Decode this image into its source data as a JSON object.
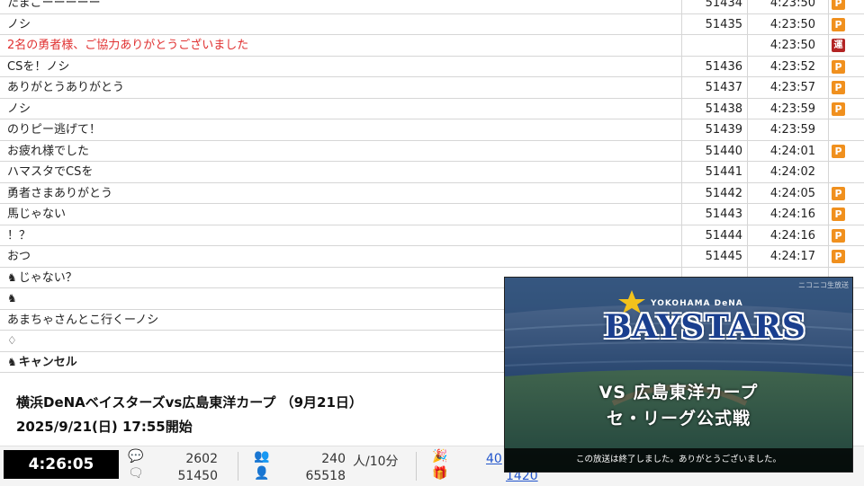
{
  "comments": [
    {
      "text": "たまごーーーーー",
      "no": "51434",
      "time": "4:23:50",
      "badge": "P"
    },
    {
      "text": "ノシ",
      "no": "51435",
      "time": "4:23:50",
      "badge": "P"
    },
    {
      "text": "2名の勇者様、ご協力ありがとうございました",
      "no": "",
      "time": "4:23:50",
      "badge": "運",
      "style": "red"
    },
    {
      "text": "CSを！ノシ",
      "no": "51436",
      "time": "4:23:52",
      "badge": "P"
    },
    {
      "text": "ありがとうありがとう",
      "no": "51437",
      "time": "4:23:57",
      "badge": "P"
    },
    {
      "text": "ノシ",
      "no": "51438",
      "time": "4:23:59",
      "badge": "P"
    },
    {
      "text": "のりピー逃げて！",
      "no": "51439",
      "time": "4:23:59",
      "badge": ""
    },
    {
      "text": "お疲れ様でした",
      "no": "51440",
      "time": "4:24:01",
      "badge": "P"
    },
    {
      "text": "ハマスタでCSを",
      "no": "51441",
      "time": "4:24:02",
      "badge": ""
    },
    {
      "text": "勇者さまありがとう",
      "no": "51442",
      "time": "4:24:05",
      "badge": "P"
    },
    {
      "text": "馬じゃない",
      "no": "51443",
      "time": "4:24:16",
      "badge": "P"
    },
    {
      "text": "！？",
      "no": "51444",
      "time": "4:24:16",
      "badge": "P"
    },
    {
      "text": "おつ",
      "no": "51445",
      "time": "4:24:17",
      "badge": "P"
    },
    {
      "text": "じゃない？",
      "no": "",
      "time": "",
      "badge": "",
      "icon": "horse-icon"
    },
    {
      "text": "",
      "no": "",
      "time": "",
      "badge": "",
      "icon": "horse-icon"
    },
    {
      "text": "あまちゃさんとこ行くーノシ",
      "no": "",
      "time": "",
      "badge": ""
    },
    {
      "text": "",
      "no": "",
      "time": "",
      "badge": "",
      "icon": "tooth-icon"
    },
    {
      "text": "キャンセル",
      "no": "",
      "time": "",
      "badge": "",
      "icon": "cancel-icon",
      "style": "bold"
    }
  ],
  "program": {
    "title": "横浜DeNAベイスターズvs広島東洋カープ （9月21日）",
    "start": "2025/9/21(日) 17:55開始"
  },
  "stats": {
    "elapsed": "4:26:05",
    "comments_per_min": "2602",
    "comments_total": "51450",
    "viewers_rate": "240",
    "viewers_unit": "人/10分",
    "viewers_total": "65518",
    "ad_points": "40",
    "gift_points": "1420"
  },
  "video": {
    "watermark": "ニコニコ生放送",
    "logo_small": "YOKOHAMA DeNA",
    "logo_big": "BAYSTARS",
    "title_line1": "VS 広島東洋カープ",
    "title_line2": "セ・リーグ公式戦",
    "end_message": "この放送は終了しました。ありがとうございました。"
  },
  "colors": {
    "badge_premium": "#f0901e",
    "badge_operator": "#b32424",
    "operator_text": "#e03030",
    "link": "#2255cc"
  }
}
